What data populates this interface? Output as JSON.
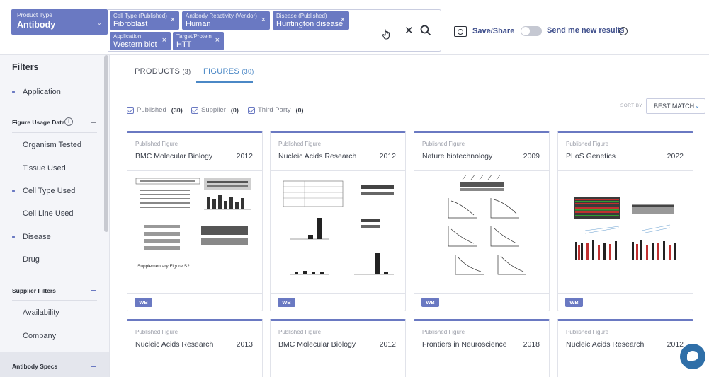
{
  "product_type": {
    "label": "Product Type",
    "value": "Antibody"
  },
  "search": {
    "chips": [
      {
        "label": "Cell Type (Published)",
        "value": "Fibroblast"
      },
      {
        "label": "Antibody Reactivity (Vendor)",
        "value": "Human"
      },
      {
        "label": "Disease (Published)",
        "value": "Huntington disease"
      },
      {
        "label": "Application",
        "value": "Western blot"
      },
      {
        "label": "Target/Protein",
        "value": "HTT"
      }
    ],
    "chip_close": "×",
    "clear_glyph": "✕"
  },
  "toolbar": {
    "save_share": "Save/Share",
    "send_me": "Send me new results",
    "info_glyph": "i"
  },
  "sidebar": {
    "title": "Filters",
    "items": [
      {
        "label": "Application",
        "dot": true
      },
      {
        "label": "Figure Usage Data",
        "section": true,
        "info": true
      },
      {
        "label": "Organism Tested",
        "dot": false
      },
      {
        "label": "Tissue Used",
        "dot": false
      },
      {
        "label": "Cell Type Used",
        "dot": true
      },
      {
        "label": "Cell Line Used",
        "dot": false
      },
      {
        "label": "Disease",
        "dot": true
      },
      {
        "label": "Drug",
        "dot": false
      },
      {
        "label": "Supplier Filters",
        "section": true
      },
      {
        "label": "Availability",
        "dot": false
      },
      {
        "label": "Company",
        "dot": false
      },
      {
        "label": "Antibody Specs",
        "section": true
      }
    ]
  },
  "tabs": [
    {
      "label": "PRODUCTS",
      "count": "(3)"
    },
    {
      "label": "FIGURES",
      "count": "(30)"
    }
  ],
  "filters_row": [
    {
      "label": "Published",
      "count": "(30)"
    },
    {
      "label": "Supplier",
      "count": "(0)"
    },
    {
      "label": "Third Party",
      "count": "(0)"
    }
  ],
  "sort": {
    "label": "SORT BY",
    "value": "BEST MATCH"
  },
  "cards": [
    {
      "type": "Published Figure",
      "journal": "BMC Molecular Biology",
      "year": "2012",
      "tag": "WB",
      "caption": "Supplementary Figure S2"
    },
    {
      "type": "Published Figure",
      "journal": "Nucleic Acids Research",
      "year": "2012",
      "tag": "WB"
    },
    {
      "type": "Published Figure",
      "journal": "Nature biotechnology",
      "year": "2009",
      "tag": "WB"
    },
    {
      "type": "Published Figure",
      "journal": "PLoS Genetics",
      "year": "2022",
      "tag": "WB"
    },
    {
      "type": "Published Figure",
      "journal": "Nucleic Acids Research",
      "year": "2013"
    },
    {
      "type": "Published Figure",
      "journal": "BMC Molecular Biology",
      "year": "2012"
    },
    {
      "type": "Published Figure",
      "journal": "Frontiers in Neuroscience",
      "year": "2018"
    },
    {
      "type": "Published Figure",
      "journal": "Nucleic Acids Research",
      "year": "2012"
    }
  ],
  "colors": {
    "accent": "#6a79c2",
    "link": "#4b88c6",
    "chat": "#2f6fa8"
  },
  "icons": [
    "chevron-down-icon",
    "close-icon",
    "search-icon",
    "hand-cursor-icon",
    "save-share-icon",
    "info-icon",
    "checkbox-icon",
    "chat-icon"
  ]
}
